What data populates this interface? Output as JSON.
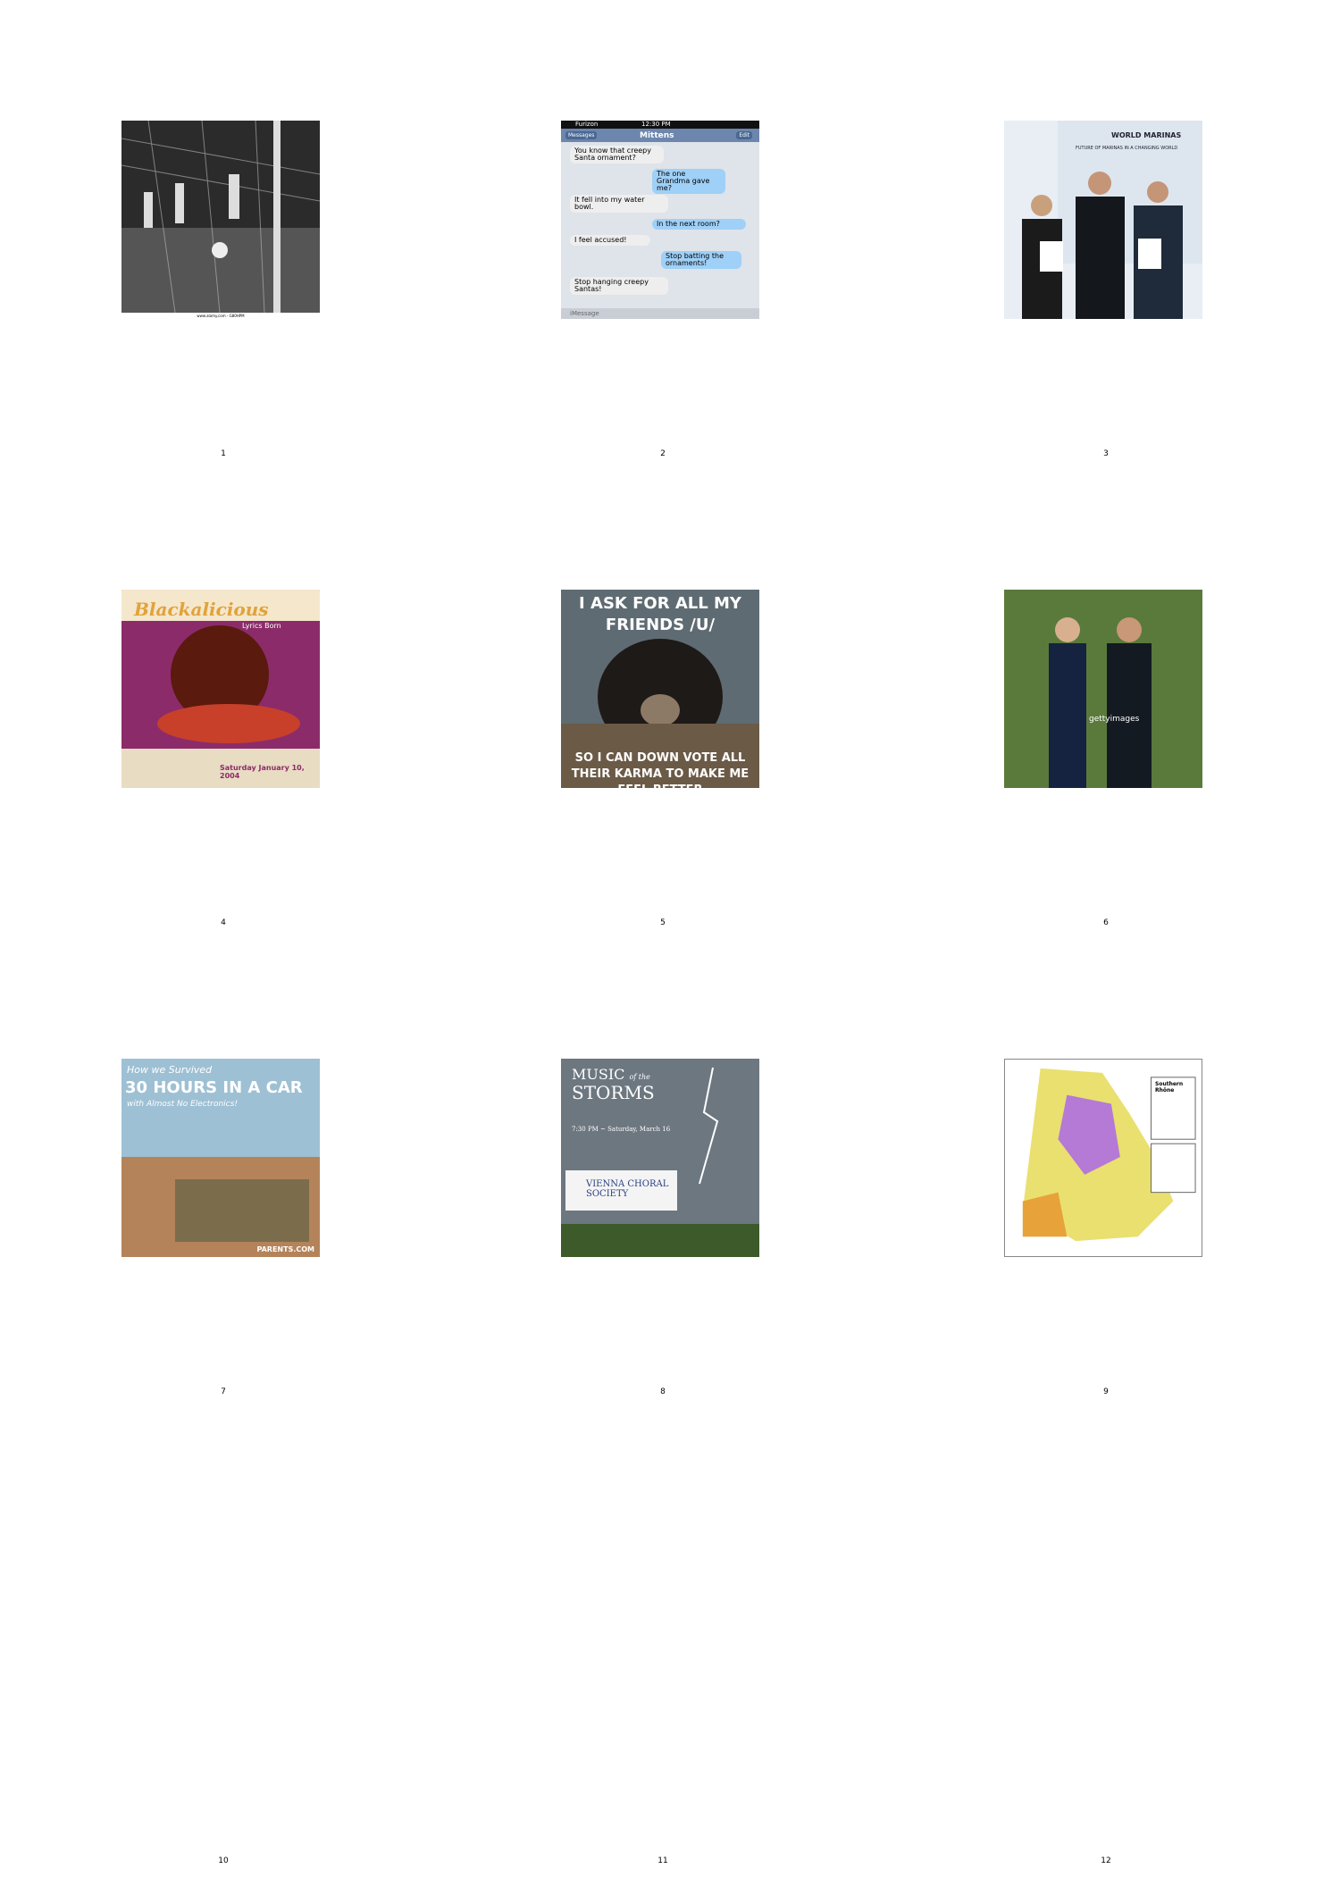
{
  "cells": [
    {
      "number": "1",
      "caption": "www.alamy.com - G80HPM"
    },
    {
      "number": "2",
      "carrier": "Furizon",
      "time": "12:30 PM",
      "back": "Messages",
      "contact": "Mittens",
      "edit": "Edit",
      "messages": [
        "You know that creepy Santa ornament?",
        "The one Grandma gave me?",
        "It fell into my water bowl.",
        "In the next room?",
        "I feel accused!",
        "Stop batting the ornaments!",
        "Stop hanging creepy Santas!"
      ],
      "input": "iMessage"
    },
    {
      "number": "3",
      "banner_title": "WORLD MARINAS",
      "banner_sub": "FUTURE OF MARINAS IN A CHANGING WORLD"
    },
    {
      "number": "4",
      "title": "Blackalicious",
      "sub": "Lyrics Born",
      "date": "Saturday January 10, 2004"
    },
    {
      "number": "5",
      "top": "I ASK FOR ALL MY FRIENDS /U/",
      "bottom": "SO I CAN DOWN VOTE ALL THEIR KARMA TO MAKE ME FEEL BETTER"
    },
    {
      "number": "6",
      "watermark": "gettyimages"
    },
    {
      "number": "7",
      "line1": "How we Survived",
      "line2": "30 HOURS IN A CAR",
      "line3": "with Almost No Electronics!",
      "site": "PARENTS.COM"
    },
    {
      "number": "8",
      "title1": "MUSIC",
      "title_of": "of the",
      "title2": "STORMS",
      "time": "7:30 PM ~ Saturday, March 16",
      "org": "VIENNA CHORAL SOCIETY"
    },
    {
      "number": "9",
      "map_title": "Southern Rhône"
    },
    {
      "number": "10"
    },
    {
      "number": "11"
    },
    {
      "number": "12"
    }
  ]
}
